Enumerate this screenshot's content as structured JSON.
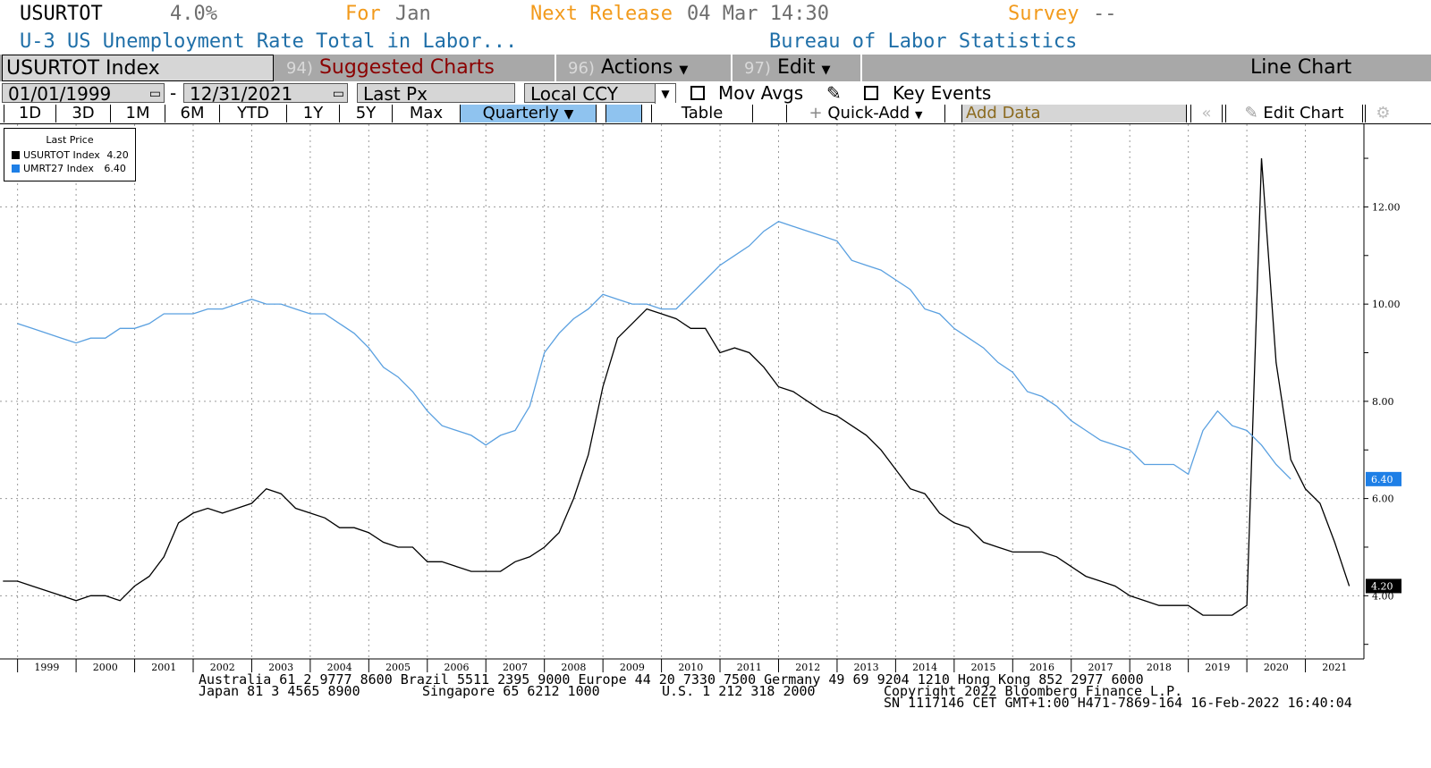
{
  "header": {
    "ticker": "USURTOT",
    "value": "4.0%",
    "for_label": "For",
    "for_value": "Jan",
    "next_release_label": "Next Release",
    "next_release_value": "04 Mar 14:30",
    "survey_label": "Survey",
    "survey_value": "--",
    "description": "U-3 US Unemployment Rate Total in Labor...",
    "source": "Bureau of Labor Statistics"
  },
  "toolbar": {
    "index_label": "USURTOT Index",
    "suggested_num": "94)",
    "suggested_label": "Suggested Charts",
    "actions_num": "96)",
    "actions_label": "Actions",
    "edit_num": "97)",
    "edit_label": "Edit",
    "chart_type_label": "Line Chart"
  },
  "controls": {
    "start_date": "01/01/1999",
    "date_sep": "-",
    "end_date": "12/31/2021",
    "price_field": "Last Px",
    "currency": "Local CCY",
    "mov_avgs_label": "Mov Avgs",
    "key_events_label": "Key Events"
  },
  "ranges": {
    "buttons": [
      "1D",
      "3D",
      "1M",
      "6M",
      "YTD",
      "1Y",
      "5Y",
      "Max"
    ],
    "frequency": "Quarterly",
    "table_label": "Table",
    "quick_add_label": "Quick-Add",
    "add_data_label": "Add Data",
    "edit_chart_label": "Edit Chart"
  },
  "legend": {
    "title": "Last Price",
    "entries": [
      {
        "name": "USURTOT Index",
        "value": "4.20",
        "color": "#000000"
      },
      {
        "name": "UMRT27 Index",
        "value": "6.40",
        "color": "#1e7fe6"
      }
    ]
  },
  "footer": {
    "line1": "Australia 61 2 9777 8600 Brazil 5511 2395 9000 Europe 44 20 7330 7500 Germany 49 69 9204 1210 Hong Kong 852 2977 6000",
    "line2a": "Japan 81 3 4565 8900",
    "line2b": "Singapore 65 6212 1000",
    "line2c": "U.S. 1 212 318 2000",
    "line2d": "Copyright 2022 Bloomberg Finance L.P.",
    "line3": "SN 1117146 CET  GMT+1:00 H471-7869-164 16-Feb-2022 16:40:04"
  },
  "colors": {
    "accent_orange": "#f29a1b",
    "series_black": "#000000",
    "series_blue": "#5aa0e0"
  },
  "chart_data": {
    "type": "line",
    "ylim": [
      2.7,
      13.7
    ],
    "yticks": [
      "4.00",
      "6.00",
      "8.00",
      "10.00",
      "12.00"
    ],
    "ytick_values": [
      4,
      6,
      8,
      10,
      12
    ],
    "xlim": [
      1998.7,
      2022.0
    ],
    "year_labels": [
      "1999",
      "2000",
      "2001",
      "2002",
      "2003",
      "2004",
      "2005",
      "2006",
      "2007",
      "2008",
      "2009",
      "2010",
      "2011",
      "2012",
      "2013",
      "2014",
      "2015",
      "2016",
      "2017",
      "2018",
      "2019",
      "2020",
      "2021"
    ],
    "last_labels": [
      "4.20",
      "6.40"
    ],
    "series": [
      {
        "name": "USURTOT Index",
        "color": "#000000",
        "points": [
          [
            1998.75,
            4.3
          ],
          [
            1999.0,
            4.3
          ],
          [
            1999.25,
            4.2
          ],
          [
            1999.5,
            4.1
          ],
          [
            1999.75,
            4.0
          ],
          [
            2000.0,
            3.9
          ],
          [
            2000.25,
            4.0
          ],
          [
            2000.5,
            4.0
          ],
          [
            2000.75,
            3.9
          ],
          [
            2001.0,
            4.2
          ],
          [
            2001.25,
            4.4
          ],
          [
            2001.5,
            4.8
          ],
          [
            2001.75,
            5.5
          ],
          [
            2002.0,
            5.7
          ],
          [
            2002.25,
            5.8
          ],
          [
            2002.5,
            5.7
          ],
          [
            2002.75,
            5.8
          ],
          [
            2003.0,
            5.9
          ],
          [
            2003.25,
            6.2
          ],
          [
            2003.5,
            6.1
          ],
          [
            2003.75,
            5.8
          ],
          [
            2004.0,
            5.7
          ],
          [
            2004.25,
            5.6
          ],
          [
            2004.5,
            5.4
          ],
          [
            2004.75,
            5.4
          ],
          [
            2005.0,
            5.3
          ],
          [
            2005.25,
            5.1
          ],
          [
            2005.5,
            5.0
          ],
          [
            2005.75,
            5.0
          ],
          [
            2006.0,
            4.7
          ],
          [
            2006.25,
            4.7
          ],
          [
            2006.5,
            4.6
          ],
          [
            2006.75,
            4.5
          ],
          [
            2007.0,
            4.5
          ],
          [
            2007.25,
            4.5
          ],
          [
            2007.5,
            4.7
          ],
          [
            2007.75,
            4.8
          ],
          [
            2008.0,
            5.0
          ],
          [
            2008.25,
            5.3
          ],
          [
            2008.5,
            6.0
          ],
          [
            2008.75,
            6.9
          ],
          [
            2009.0,
            8.3
          ],
          [
            2009.25,
            9.3
          ],
          [
            2009.5,
            9.6
          ],
          [
            2009.75,
            9.9
          ],
          [
            2010.0,
            9.8
          ],
          [
            2010.25,
            9.7
          ],
          [
            2010.5,
            9.5
          ],
          [
            2010.75,
            9.5
          ],
          [
            2011.0,
            9.0
          ],
          [
            2011.25,
            9.1
          ],
          [
            2011.5,
            9.0
          ],
          [
            2011.75,
            8.7
          ],
          [
            2012.0,
            8.3
          ],
          [
            2012.25,
            8.2
          ],
          [
            2012.5,
            8.0
          ],
          [
            2012.75,
            7.8
          ],
          [
            2013.0,
            7.7
          ],
          [
            2013.25,
            7.5
          ],
          [
            2013.5,
            7.3
          ],
          [
            2013.75,
            7.0
          ],
          [
            2014.0,
            6.6
          ],
          [
            2014.25,
            6.2
          ],
          [
            2014.5,
            6.1
          ],
          [
            2014.75,
            5.7
          ],
          [
            2015.0,
            5.5
          ],
          [
            2015.25,
            5.4
          ],
          [
            2015.5,
            5.1
          ],
          [
            2015.75,
            5.0
          ],
          [
            2016.0,
            4.9
          ],
          [
            2016.25,
            4.9
          ],
          [
            2016.5,
            4.9
          ],
          [
            2016.75,
            4.8
          ],
          [
            2017.0,
            4.6
          ],
          [
            2017.25,
            4.4
          ],
          [
            2017.5,
            4.3
          ],
          [
            2017.75,
            4.2
          ],
          [
            2018.0,
            4.0
          ],
          [
            2018.25,
            3.9
          ],
          [
            2018.5,
            3.8
          ],
          [
            2018.75,
            3.8
          ],
          [
            2019.0,
            3.8
          ],
          [
            2019.25,
            3.6
          ],
          [
            2019.5,
            3.6
          ],
          [
            2019.75,
            3.6
          ],
          [
            2020.0,
            3.8
          ],
          [
            2020.25,
            13.0
          ],
          [
            2020.5,
            8.8
          ],
          [
            2020.75,
            6.8
          ],
          [
            2021.0,
            6.2
          ],
          [
            2021.25,
            5.9
          ],
          [
            2021.5,
            5.1
          ],
          [
            2021.75,
            4.2
          ]
        ]
      },
      {
        "name": "UMRT27 Index",
        "color": "#5aa0e0",
        "points": [
          [
            1999.0,
            9.6
          ],
          [
            1999.25,
            9.5
          ],
          [
            1999.5,
            9.4
          ],
          [
            1999.75,
            9.3
          ],
          [
            2000.0,
            9.2
          ],
          [
            2000.25,
            9.3
          ],
          [
            2000.5,
            9.3
          ],
          [
            2000.75,
            9.5
          ],
          [
            2001.0,
            9.5
          ],
          [
            2001.25,
            9.6
          ],
          [
            2001.5,
            9.8
          ],
          [
            2001.75,
            9.8
          ],
          [
            2002.0,
            9.8
          ],
          [
            2002.25,
            9.9
          ],
          [
            2002.5,
            9.9
          ],
          [
            2002.75,
            10.0
          ],
          [
            2003.0,
            10.1
          ],
          [
            2003.25,
            10.0
          ],
          [
            2003.5,
            10.0
          ],
          [
            2003.75,
            9.9
          ],
          [
            2004.0,
            9.8
          ],
          [
            2004.25,
            9.8
          ],
          [
            2004.5,
            9.6
          ],
          [
            2004.75,
            9.4
          ],
          [
            2005.0,
            9.1
          ],
          [
            2005.25,
            8.7
          ],
          [
            2005.5,
            8.5
          ],
          [
            2005.75,
            8.2
          ],
          [
            2006.0,
            7.8
          ],
          [
            2006.25,
            7.5
          ],
          [
            2006.5,
            7.4
          ],
          [
            2006.75,
            7.3
          ],
          [
            2007.0,
            7.1
          ],
          [
            2007.25,
            7.3
          ],
          [
            2007.5,
            7.4
          ],
          [
            2007.75,
            7.9
          ],
          [
            2008.0,
            9.0
          ],
          [
            2008.25,
            9.4
          ],
          [
            2008.5,
            9.7
          ],
          [
            2008.75,
            9.9
          ],
          [
            2009.0,
            10.2
          ],
          [
            2009.25,
            10.1
          ],
          [
            2009.5,
            10.0
          ],
          [
            2009.75,
            10.0
          ],
          [
            2010.0,
            9.9
          ],
          [
            2010.25,
            9.9
          ],
          [
            2010.5,
            10.2
          ],
          [
            2010.75,
            10.5
          ],
          [
            2011.0,
            10.8
          ],
          [
            2011.25,
            11.0
          ],
          [
            2011.5,
            11.2
          ],
          [
            2011.75,
            11.5
          ],
          [
            2012.0,
            11.7
          ],
          [
            2012.25,
            11.6
          ],
          [
            2012.5,
            11.5
          ],
          [
            2012.75,
            11.4
          ],
          [
            2013.0,
            11.3
          ],
          [
            2013.25,
            10.9
          ],
          [
            2013.5,
            10.8
          ],
          [
            2013.75,
            10.7
          ],
          [
            2014.0,
            10.5
          ],
          [
            2014.25,
            10.3
          ],
          [
            2014.5,
            9.9
          ],
          [
            2014.75,
            9.8
          ],
          [
            2015.0,
            9.5
          ],
          [
            2015.25,
            9.3
          ],
          [
            2015.5,
            9.1
          ],
          [
            2015.75,
            8.8
          ],
          [
            2016.0,
            8.6
          ],
          [
            2016.25,
            8.2
          ],
          [
            2016.5,
            8.1
          ],
          [
            2016.75,
            7.9
          ],
          [
            2017.0,
            7.6
          ],
          [
            2017.25,
            7.4
          ],
          [
            2017.5,
            7.2
          ],
          [
            2017.75,
            7.1
          ],
          [
            2018.0,
            7.0
          ],
          [
            2018.25,
            6.7
          ],
          [
            2018.5,
            6.7
          ],
          [
            2018.75,
            6.7
          ],
          [
            2019.0,
            6.5
          ],
          [
            2019.25,
            7.4
          ],
          [
            2019.5,
            7.8
          ],
          [
            2019.75,
            7.5
          ],
          [
            2020.0,
            7.4
          ],
          [
            2020.25,
            7.1
          ],
          [
            2020.5,
            6.7
          ],
          [
            2020.75,
            6.4
          ]
        ]
      }
    ]
  }
}
